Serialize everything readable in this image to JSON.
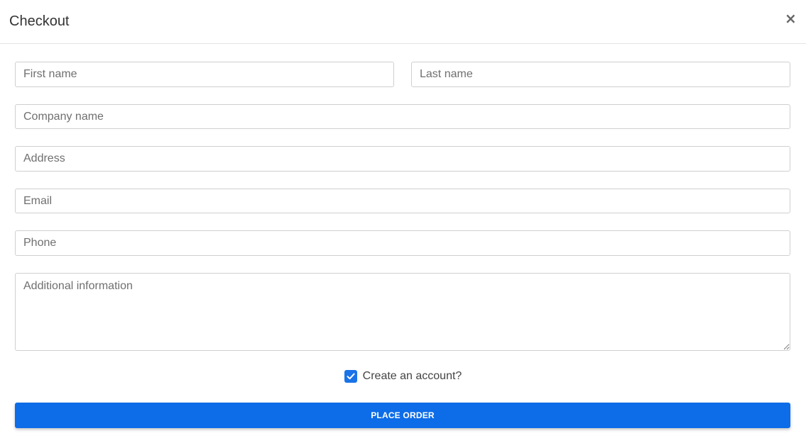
{
  "modal": {
    "title": "Checkout",
    "close_label": "×"
  },
  "form": {
    "first_name": {
      "placeholder": "First name",
      "value": ""
    },
    "last_name": {
      "placeholder": "Last name",
      "value": ""
    },
    "company_name": {
      "placeholder": "Company name",
      "value": ""
    },
    "address": {
      "placeholder": "Address",
      "value": ""
    },
    "email": {
      "placeholder": "Email",
      "value": ""
    },
    "phone": {
      "placeholder": "Phone",
      "value": ""
    },
    "additional_info": {
      "placeholder": "Additional information",
      "value": ""
    },
    "create_account": {
      "label": "Create an account?",
      "checked": true
    }
  },
  "actions": {
    "place_order_label": "PLACE ORDER"
  },
  "colors": {
    "accent": "#0d6ce8",
    "checkbox": "#1a73e8",
    "border": "#cfcfcf"
  },
  "icons": {
    "close": "close-icon",
    "checkbox": "checkmark-icon"
  }
}
